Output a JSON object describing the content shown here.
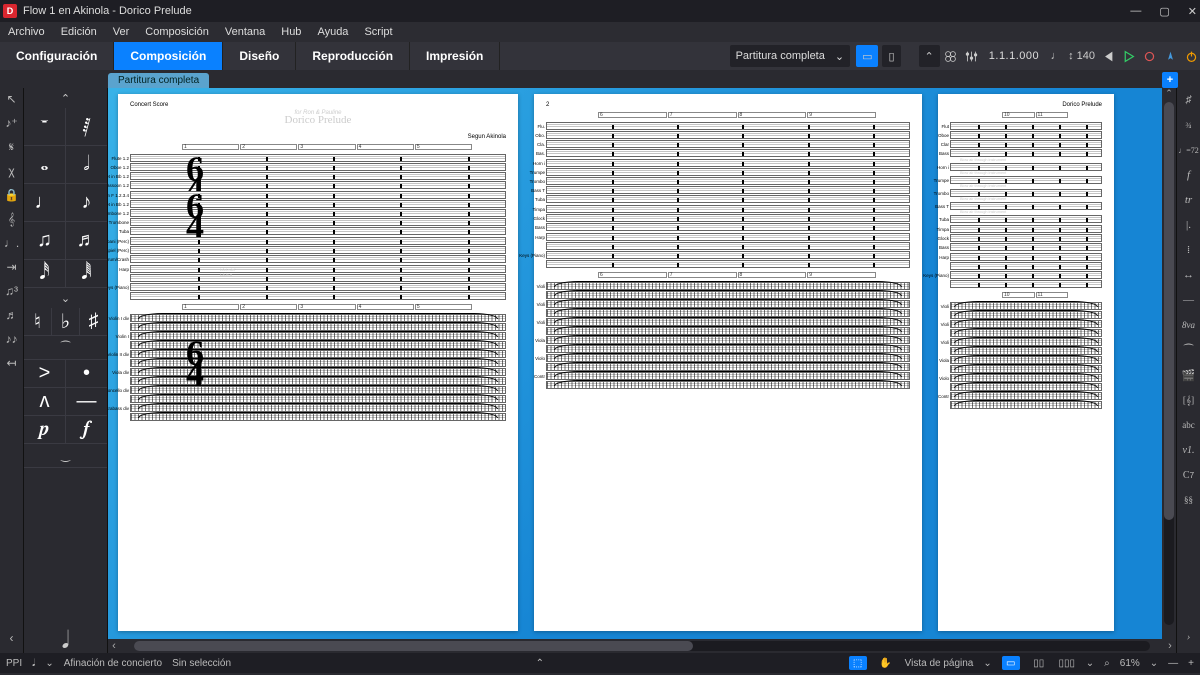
{
  "window": {
    "title": "Flow 1 en Akinola - Dorico Prelude"
  },
  "menu": [
    "Archivo",
    "Edición",
    "Ver",
    "Composición",
    "Ventana",
    "Hub",
    "Ayuda",
    "Script"
  ],
  "modes": [
    "Configuración",
    "Composición",
    "Diseño",
    "Reproducción",
    "Impresión"
  ],
  "activeMode": 1,
  "layoutSelector": "Partitura completa",
  "transport": {
    "position": "1.1.1.000",
    "tempo": "140"
  },
  "tab": "Partitura completa",
  "leftToolIcons": [
    "arrow",
    "note-input",
    "tie",
    "scissors",
    "lock",
    "clef",
    "dot",
    "ledger",
    "tuplet",
    "grace",
    "cue",
    "expand"
  ],
  "noteGrid": [
    [
      "𝄻",
      "𝅁"
    ],
    [
      "𝅝",
      "𝅗𝅥"
    ],
    [
      "♩",
      "♪"
    ],
    [
      "♫",
      "♬"
    ],
    [
      "𝅘𝅥𝅰",
      "𝅘𝅥𝅱"
    ]
  ],
  "noteArtic": [
    [
      "♮",
      "♭",
      "♯"
    ],
    [
      "⁀",
      ""
    ],
    [
      ">",
      "•"
    ],
    [
      "ʌ",
      "—"
    ],
    [
      "𝆏",
      "𝆑"
    ],
    [
      "‿",
      ""
    ]
  ],
  "rightToolLabels": [
    "♯♯",
    "3/4",
    "J=72",
    "𝆑",
    "�置",
    "|.",
    "⋮⋮",
    "↔",
    "—",
    "8va",
    "⁀",
    "🎬",
    "[𝄞]",
    "abc",
    "v1.",
    "C7",
    "§§"
  ],
  "score": {
    "header": {
      "left": "Concert Score",
      "dedication": "for Ron & Pauline",
      "title": "Dorico Prelude",
      "composer": "Segun Akinola"
    },
    "barNumbers": {
      "p1": [
        "1",
        "2",
        "3",
        "4",
        "5"
      ],
      "p2": [
        "6",
        "7",
        "8",
        "9"
      ],
      "p3": [
        "10",
        "11"
      ]
    },
    "page2num": "2",
    "page3hdr": "Dorico Prelude",
    "winds": [
      "Flute 1.2",
      "Oboe 1.2",
      "Clarinet in Bb 1.2",
      "Bassoon 1.2"
    ],
    "brass": [
      "Horn in F 1.2.3.4",
      "Trumpet in Bb 1.2",
      "Trombone 1.2",
      "Bass Trombone",
      "Tuba"
    ],
    "perc": [
      "Timpani (Perc)",
      "Glockenspiel (Perc)",
      "Bass Drum/Crash"
    ],
    "keys": [
      "Harp",
      "Keys (Piano)"
    ],
    "strings": [
      "Violin I div",
      "Violin I",
      "Violin II div",
      "Viola div",
      "Violoncello div",
      "Contrabass div"
    ],
    "brassNote": "Blow air through instrument",
    "harpText": "LA-b-def\nLA-b-a"
  },
  "status": {
    "ppi": "PPI",
    "pitch": "Afinación de concierto",
    "selection": "Sin selección",
    "viewMode": "Vista de página",
    "zoom": "61%"
  }
}
